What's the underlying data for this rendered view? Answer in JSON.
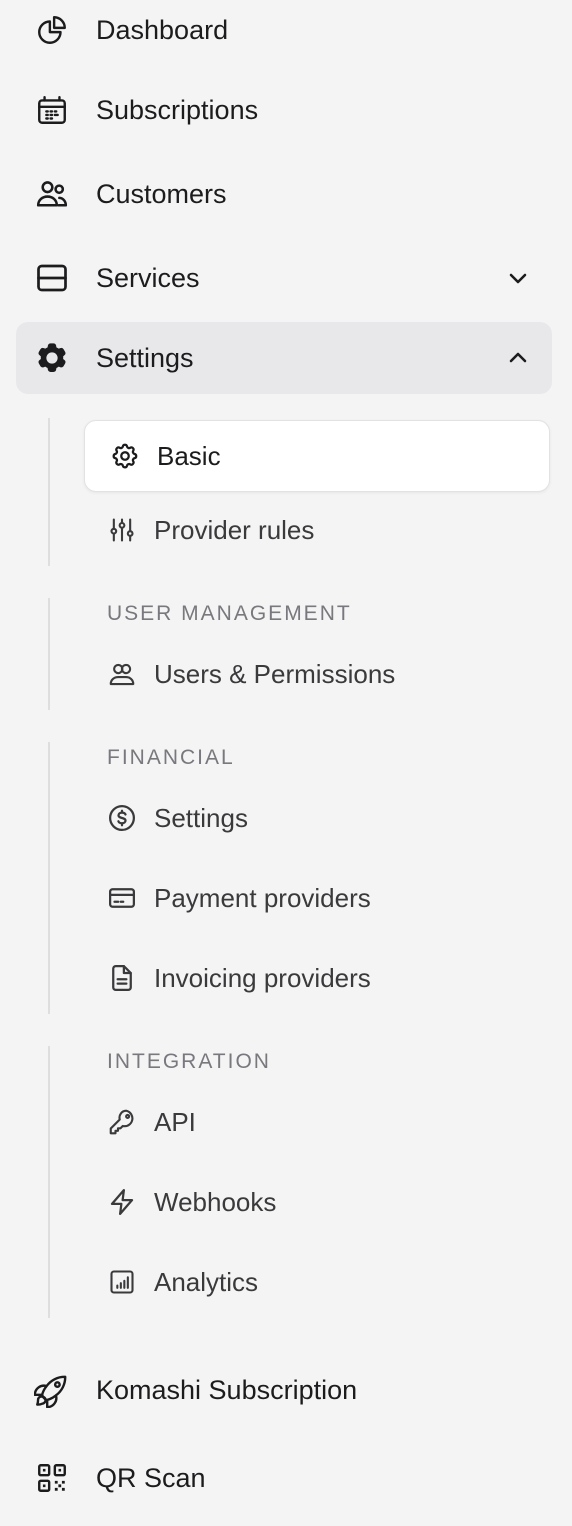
{
  "nav": {
    "dashboard": {
      "label": "Dashboard",
      "icon": "pie-chart-icon"
    },
    "subscriptions": {
      "label": "Subscriptions",
      "icon": "calendar-icon"
    },
    "customers": {
      "label": "Customers",
      "icon": "users-icon"
    },
    "services": {
      "label": "Services",
      "icon": "server-icon",
      "expanded": false
    },
    "settings": {
      "label": "Settings",
      "icon": "cog-icon",
      "expanded": true
    },
    "komashi": {
      "label": "Komashi Subscription",
      "icon": "rocket-icon"
    },
    "qr": {
      "label": "QR Scan",
      "icon": "qr-code-icon"
    }
  },
  "settings_menu": {
    "general": {
      "basic": {
        "label": "Basic",
        "icon": "cog-outline-icon",
        "selected": true
      },
      "provider_rules": {
        "label": "Provider rules",
        "icon": "sliders-icon"
      }
    },
    "user_management": {
      "heading": "USER MANAGEMENT",
      "users_permissions": {
        "label": "Users & Permissions",
        "icon": "users-outline-icon"
      }
    },
    "financial": {
      "heading": "FINANCIAL",
      "settings": {
        "label": "Settings",
        "icon": "dollar-circle-icon"
      },
      "payment_providers": {
        "label": "Payment providers",
        "icon": "credit-card-icon"
      },
      "invoicing_providers": {
        "label": "Invoicing providers",
        "icon": "document-icon"
      }
    },
    "integration": {
      "heading": "INTEGRATION",
      "api": {
        "label": "API",
        "icon": "key-icon"
      },
      "webhooks": {
        "label": "Webhooks",
        "icon": "bolt-icon"
      },
      "analytics": {
        "label": "Analytics",
        "icon": "bar-chart-icon"
      }
    }
  },
  "colors": {
    "background": "#f4f4f4",
    "active_bg": "#e8e8ea",
    "selected_bg": "#ffffff",
    "text": "#1c1c1e",
    "muted": "#78787e"
  }
}
